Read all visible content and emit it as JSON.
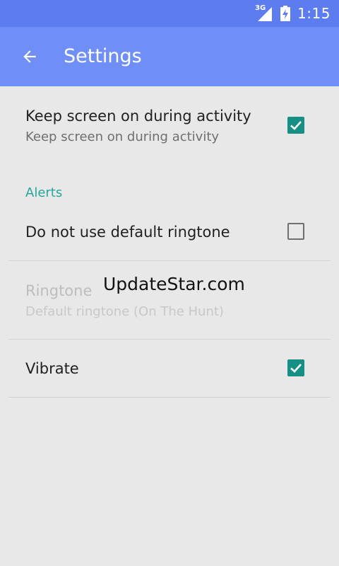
{
  "status_bar": {
    "network_type": "3G",
    "time": "1:15",
    "color": "#5c7cf0"
  },
  "app_bar": {
    "title": "Settings",
    "back_icon": "arrow-back-icon",
    "color": "#6f8ff7"
  },
  "settings": {
    "keep_screen_on": {
      "title": "Keep screen on during activity",
      "summary": "Keep screen on during activity",
      "checked": true
    },
    "alerts_header": "Alerts",
    "default_ringtone": {
      "title": "Do not use default ringtone",
      "checked": false
    },
    "ringtone": {
      "title": "Ringtone",
      "summary": "Default ringtone (On The Hunt)",
      "enabled": false
    },
    "vibrate": {
      "title": "Vibrate",
      "checked": true
    }
  },
  "watermark": "UpdateStar.com",
  "colors": {
    "accent": "#26a69a",
    "checkbox_checked": "#168f84",
    "background": "#e8e8e8"
  }
}
